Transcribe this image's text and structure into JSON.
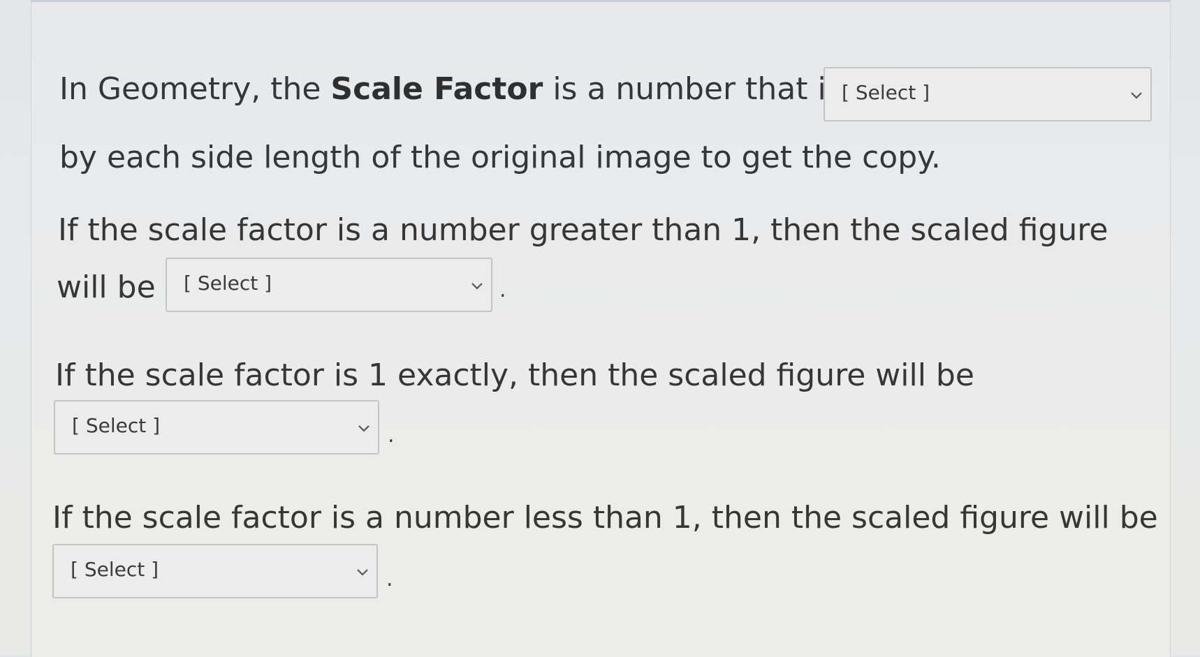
{
  "question": {
    "line1": {
      "prefix": "In Geometry, the ",
      "bold": "Scale Factor",
      "suffix": " is a number that is"
    },
    "line2": "by each side length of the original image to get the copy.",
    "line3": "If the scale factor is a number greater than 1, then the scaled figure",
    "line4_prefix": "will be",
    "line5": "If the scale factor is 1 exactly, then the scaled figure will be",
    "line6": "If the scale factor is a number less than 1, then the scaled figure will be",
    "period": "."
  },
  "dropdowns": [
    {
      "selected": "[ Select ]",
      "icon": "chevron-down-icon"
    },
    {
      "selected": "[ Select ]",
      "icon": "chevron-down-icon"
    },
    {
      "selected": "[ Select ]",
      "icon": "chevron-down-icon"
    },
    {
      "selected": "[ Select ]",
      "icon": "chevron-down-icon"
    }
  ]
}
